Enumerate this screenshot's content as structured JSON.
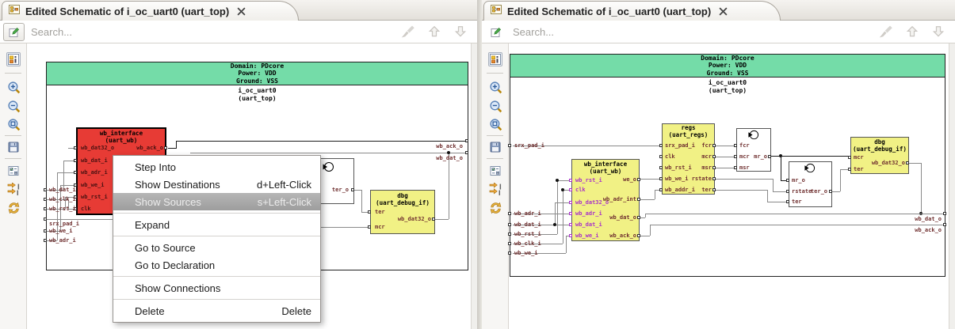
{
  "colors": {
    "domain_band": "#74DCA8",
    "highlight_block_red": "#E73B35",
    "module_block_yellow": "#F1F185",
    "highlight_port_purple": "#A832C8",
    "port_label_maroon": "#703030"
  },
  "icons": {
    "tab-schematic-icon": "netlist page",
    "close-icon": "x-cross",
    "edit-search-icon": "page with green pen",
    "clear-icon": "broom",
    "prev-icon": "up outline arrow",
    "next-icon": "down outline arrow",
    "properties-icon": "boxes with i",
    "zoom-in-icon": "magnifier plus",
    "zoom-out-icon": "magnifier minus",
    "zoom-fit-icon": "magnifier box",
    "save-icon": "floppy disk",
    "options-icon": "checkbox form",
    "trace-signals-icon": "two orange arrows",
    "reload-icon": "circular orange arrows",
    "clock-symbol": "circle with input wedge"
  },
  "panes": [
    {
      "tab": {
        "title": "Edited Schematic of i_oc_uart0 (uart_top)"
      },
      "search": {
        "placeholder": "Search..."
      },
      "schematic": {
        "domain": "Domain: PDcore",
        "power": "Power: VDD",
        "ground": "Ground: VSS",
        "instance": "i_oc_uart0",
        "instance_type": "(uart_top)",
        "blocks": [
          {
            "name": "wb_interface",
            "type": "(uart_wb)",
            "left_ports": [
              "wb_dat32_o",
              "wb_dat_i",
              "wb_adr_i",
              "wb_we_i",
              "wb_rst_i",
              "clk"
            ],
            "right_ports": [
              "wb_ack_o"
            ]
          },
          {
            "name": "",
            "type": "",
            "left_ports": [],
            "right_ports": [
              "ter_o"
            ]
          },
          {
            "name": "dbg",
            "type": "(uart_debug_if)",
            "left_ports": [
              "ter",
              "mcr"
            ],
            "right_ports": [
              "wb_dat32_o"
            ]
          }
        ],
        "edge_ports_left": [
          "wb_dat_i",
          "wb_clk_i",
          "wb_rst_i",
          "srx_pad_i",
          "wb_we_i",
          "wb_adr_i"
        ],
        "edge_ports_right": [
          "wb_ack_o",
          "wb_dat_o"
        ]
      },
      "context_menu": {
        "items": [
          {
            "label": "Step Into",
            "shortcut": ""
          },
          {
            "label": "Show Destinations",
            "shortcut": "d+Left-Click"
          },
          {
            "label": "Show Sources",
            "shortcut": "s+Left-Click"
          },
          {
            "label": "Expand",
            "shortcut": ""
          },
          {
            "label": "Go to Source",
            "shortcut": ""
          },
          {
            "label": "Go to Declaration",
            "shortcut": ""
          },
          {
            "label": "Show Connections",
            "shortcut": ""
          },
          {
            "label": "Delete",
            "shortcut": "Delete"
          }
        ]
      }
    },
    {
      "tab": {
        "title": "Edited Schematic of i_oc_uart0 (uart_top)"
      },
      "search": {
        "placeholder": "Search..."
      },
      "schematic": {
        "domain": "Domain: PDcore",
        "power": "Power: VDD",
        "ground": "Ground: VSS",
        "instance": "i_oc_uart0",
        "instance_type": "(uart_top)",
        "blocks": [
          {
            "name": "wb_interface",
            "type": "(uart_wb)",
            "left_ports": [
              "wb_rst_i",
              "clk",
              "wb_dat32_o",
              "wb_adr_i",
              "wb_dat_i",
              "wb_we_i"
            ],
            "right_ports": [
              "we_o",
              "wb_adr_int",
              "wb_dat_o",
              "wb_ack_o"
            ]
          },
          {
            "name": "regs",
            "type": "(uart_regs)",
            "left_ports": [
              "srx_pad_i",
              "clk",
              "wb_rst_i",
              "wb_we_i",
              "wb_addr_i"
            ],
            "right_ports": [
              "fcr",
              "mcr",
              "msr",
              "rstate",
              "ter"
            ]
          },
          {
            "name": "",
            "type": "",
            "left_ports": [
              "fcr",
              "mcr",
              "msr"
            ],
            "right_ports": [
              "mr_o"
            ]
          },
          {
            "name": "",
            "type": "",
            "left_ports": [
              "mr_o",
              "rstate",
              "ter"
            ],
            "right_ports": [
              "ter_o"
            ]
          },
          {
            "name": "dbg",
            "type": "(uart_debug_if)",
            "left_ports": [
              "mcr",
              "ter"
            ],
            "right_ports": [
              "wb_dat32_o"
            ]
          }
        ],
        "edge_ports_left": [
          "srx_pad_i",
          "wb_adr_i",
          "wb_dat_i",
          "wb_rst_i",
          "wb_clk_i",
          "wb_we_i"
        ],
        "edge_ports_right": [
          "wb_dat_o",
          "wb_ack_o"
        ]
      }
    }
  ]
}
